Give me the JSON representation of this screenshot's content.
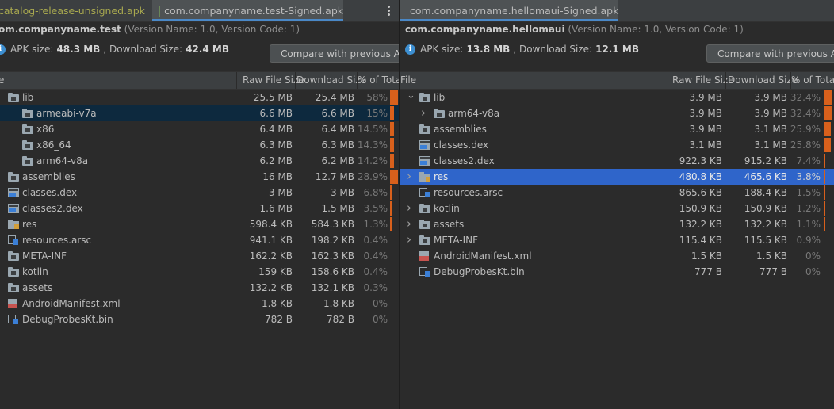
{
  "left": {
    "tabs": [
      {
        "label": "catalog-release-unsigned.apk"
      },
      {
        "label": "com.companyname.test-Signed.apk"
      }
    ],
    "package_name": "om.companyname.test",
    "version_text": "(Version Name: 1.0, Version Code: 1)",
    "apk_size_label": "APK size:",
    "apk_size_value": "48.3 MB",
    "download_size_label": ", Download Size:",
    "download_size_value": "42.4 MB",
    "compare_button": "Compare with previous APK",
    "columns": {
      "file": "e",
      "raw": "Raw File Size",
      "download": "Download Size",
      "percent": "% of Total"
    },
    "rows": [
      {
        "name": "lib",
        "icon": "folder-icon",
        "raw": "25.5 MB",
        "download": "25.4 MB",
        "percent": "58%",
        "frac": 0.58
      },
      {
        "name": "armeabi-v7a",
        "icon": "folder-icon",
        "raw": "6.6 MB",
        "download": "6.6 MB",
        "percent": "15%",
        "frac": 0.15
      },
      {
        "name": "x86",
        "icon": "folder-icon",
        "raw": "6.4 MB",
        "download": "6.4 MB",
        "percent": "14.5%",
        "frac": 0.145
      },
      {
        "name": "x86_64",
        "icon": "folder-icon",
        "raw": "6.3 MB",
        "download": "6.3 MB",
        "percent": "14.3%",
        "frac": 0.143
      },
      {
        "name": "arm64-v8a",
        "icon": "folder-icon",
        "raw": "6.2 MB",
        "download": "6.2 MB",
        "percent": "14.2%",
        "frac": 0.142
      },
      {
        "name": "assemblies",
        "icon": "folder-icon",
        "raw": "16 MB",
        "download": "12.7 MB",
        "percent": "28.9%",
        "frac": 0.289
      },
      {
        "name": "classes.dex",
        "icon": "dex-icon",
        "raw": "3 MB",
        "download": "3 MB",
        "percent": "6.8%",
        "frac": 0.068
      },
      {
        "name": "classes2.dex",
        "icon": "dex-icon",
        "raw": "1.6 MB",
        "download": "1.5 MB",
        "percent": "3.5%",
        "frac": 0.035
      },
      {
        "name": "res",
        "icon": "res-folder-icon",
        "raw": "598.4 KB",
        "download": "584.3 KB",
        "percent": "1.3%",
        "frac": 0.013
      },
      {
        "name": "resources.arsc",
        "icon": "arsc-file-icon",
        "raw": "941.1 KB",
        "download": "198.2 KB",
        "percent": "0.4%",
        "frac": 0.004
      },
      {
        "name": "META-INF",
        "icon": "folder-icon",
        "raw": "162.2 KB",
        "download": "162.3 KB",
        "percent": "0.4%",
        "frac": 0.004
      },
      {
        "name": "kotlin",
        "icon": "folder-icon",
        "raw": "159 KB",
        "download": "158.6 KB",
        "percent": "0.4%",
        "frac": 0.004
      },
      {
        "name": "assets",
        "icon": "folder-icon",
        "raw": "132.2 KB",
        "download": "132.1 KB",
        "percent": "0.3%",
        "frac": 0.003
      },
      {
        "name": "AndroidManifest.xml",
        "icon": "xml-file-icon",
        "raw": "1.8 KB",
        "download": "1.8 KB",
        "percent": "0%",
        "frac": 0
      },
      {
        "name": "DebugProbesKt.bin",
        "icon": "bin-file-icon",
        "raw": "782 B",
        "download": "782 B",
        "percent": "0%",
        "frac": 0
      }
    ]
  },
  "right": {
    "tabs": [
      {
        "label": "com.companyname.hellomaui-Signed.apk"
      }
    ],
    "package_name": "com.companyname.hellomaui",
    "version_text": "(Version Name: 1.0, Version Code: 1)",
    "apk_size_label": "APK size:",
    "apk_size_value": "13.8 MB",
    "download_size_label": ", Download Size:",
    "download_size_value": "12.1 MB",
    "compare_button": "Compare with previous APK",
    "columns": {
      "file": "File",
      "raw": "Raw File Size",
      "download": "Download Size",
      "percent": "% of Total"
    },
    "rows": [
      {
        "name": "lib",
        "icon": "folder-icon",
        "raw": "3.9 MB",
        "download": "3.9 MB",
        "percent": "32.4%",
        "frac": 0.324
      },
      {
        "name": "arm64-v8a",
        "icon": "folder-icon",
        "raw": "3.9 MB",
        "download": "3.9 MB",
        "percent": "32.4%",
        "frac": 0.324
      },
      {
        "name": "assemblies",
        "icon": "folder-icon",
        "raw": "3.9 MB",
        "download": "3.1 MB",
        "percent": "25.9%",
        "frac": 0.259
      },
      {
        "name": "classes.dex",
        "icon": "dex-icon",
        "raw": "3.1 MB",
        "download": "3.1 MB",
        "percent": "25.8%",
        "frac": 0.258
      },
      {
        "name": "classes2.dex",
        "icon": "dex-icon",
        "raw": "922.3 KB",
        "download": "915.2 KB",
        "percent": "7.4%",
        "frac": 0.074
      },
      {
        "name": "res",
        "icon": "res-folder-icon",
        "raw": "480.8 KB",
        "download": "465.6 KB",
        "percent": "3.8%",
        "frac": 0.038
      },
      {
        "name": "resources.arsc",
        "icon": "arsc-file-icon",
        "raw": "865.6 KB",
        "download": "188.4 KB",
        "percent": "1.5%",
        "frac": 0.015
      },
      {
        "name": "kotlin",
        "icon": "folder-icon",
        "raw": "150.9 KB",
        "download": "150.9 KB",
        "percent": "1.2%",
        "frac": 0.012
      },
      {
        "name": "assets",
        "icon": "folder-icon",
        "raw": "132.2 KB",
        "download": "132.2 KB",
        "percent": "1.1%",
        "frac": 0.011
      },
      {
        "name": "META-INF",
        "icon": "folder-icon",
        "raw": "115.4 KB",
        "download": "115.5 KB",
        "percent": "0.9%",
        "frac": 0.009
      },
      {
        "name": "AndroidManifest.xml",
        "icon": "xml-file-icon",
        "raw": "1.5 KB",
        "download": "1.5 KB",
        "percent": "0%",
        "frac": 0
      },
      {
        "name": "DebugProbesKt.bin",
        "icon": "bin-file-icon",
        "raw": "777 B",
        "download": "777 B",
        "percent": "0%",
        "frac": 0
      }
    ]
  },
  "colors": {
    "bar": "#d8601c",
    "selection_dark": "#0d293e",
    "selection_blue": "#2f65ca",
    "tab_underline": "#4a88c7"
  }
}
